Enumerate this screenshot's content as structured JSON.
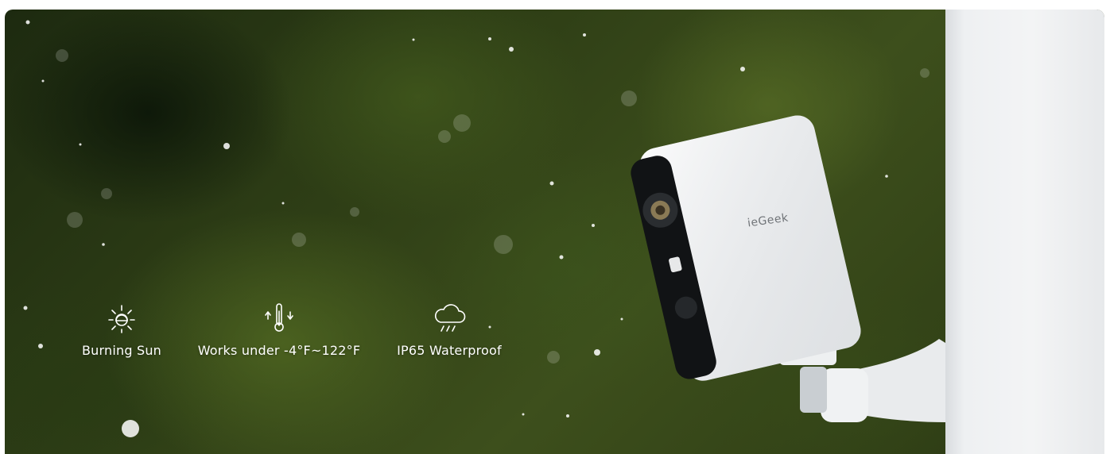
{
  "features": [
    {
      "icon": "sun-icon",
      "label": "Burning Sun"
    },
    {
      "icon": "temperature-icon",
      "label": "Works under -4°F~122°F"
    },
    {
      "icon": "rain-cloud-icon",
      "label": "IP65 Waterproof"
    }
  ],
  "camera": {
    "brand": "ieGeek"
  },
  "colors": {
    "text": "#ffffff",
    "foliage": "#2f3f16",
    "wall": "#eef0f2"
  }
}
